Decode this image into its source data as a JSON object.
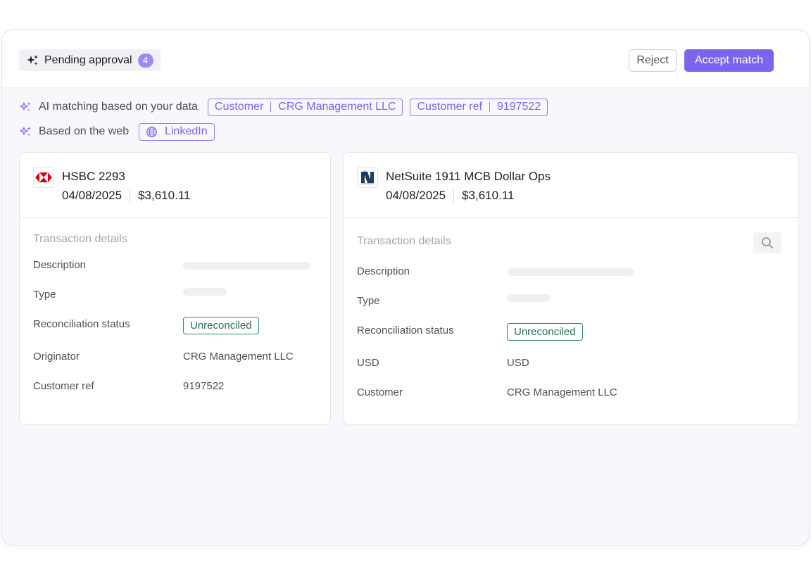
{
  "header": {
    "pending_label": "Pending approval",
    "pending_count": "4",
    "reject_label": "Reject",
    "accept_label": "Accept match"
  },
  "ai_matching": {
    "data_label": "AI matching based on your data",
    "data_tags": [
      {
        "key": "Customer",
        "value": "CRG Management LLC"
      },
      {
        "key": "Customer ref",
        "value": "9197522"
      }
    ],
    "web_label": "Based on the web",
    "web_tags": [
      {
        "label": "LinkedIn",
        "icon": "globe-icon"
      }
    ]
  },
  "left_card": {
    "logo": "hsbc-logo",
    "account_name": "HSBC 2293",
    "date": "04/08/2025",
    "amount": "$3,610.11",
    "section_title": "Transaction details",
    "fields": {
      "description_label": "Description",
      "type_label": "Type",
      "status_label": "Reconciliation status",
      "status_value": "Unreconciled",
      "originator_label": "Originator",
      "originator_value": "CRG Management LLC",
      "customer_ref_label": "Customer ref",
      "customer_ref_value": "9197522"
    }
  },
  "right_card": {
    "logo": "netsuite-logo",
    "account_name": "NetSuite 1911 MCB Dollar Ops",
    "date": "04/08/2025",
    "amount": "$3,610.11",
    "section_title": "Transaction details",
    "search_icon": "search-icon",
    "fields": {
      "description_label": "Description",
      "type_label": "Type",
      "status_label": "Reconciliation status",
      "status_value": "Unreconciled",
      "currency_label": "USD",
      "currency_value": "USD",
      "customer_label": "Customer",
      "customer_value": "CRG Management LLC"
    }
  },
  "colors": {
    "accent": "#7a66ee",
    "badge": "#9b8cf0",
    "status_green": "#2e8a5f",
    "hsbc_red": "#db0011",
    "netsuite_navy": "#1b3d5f"
  }
}
